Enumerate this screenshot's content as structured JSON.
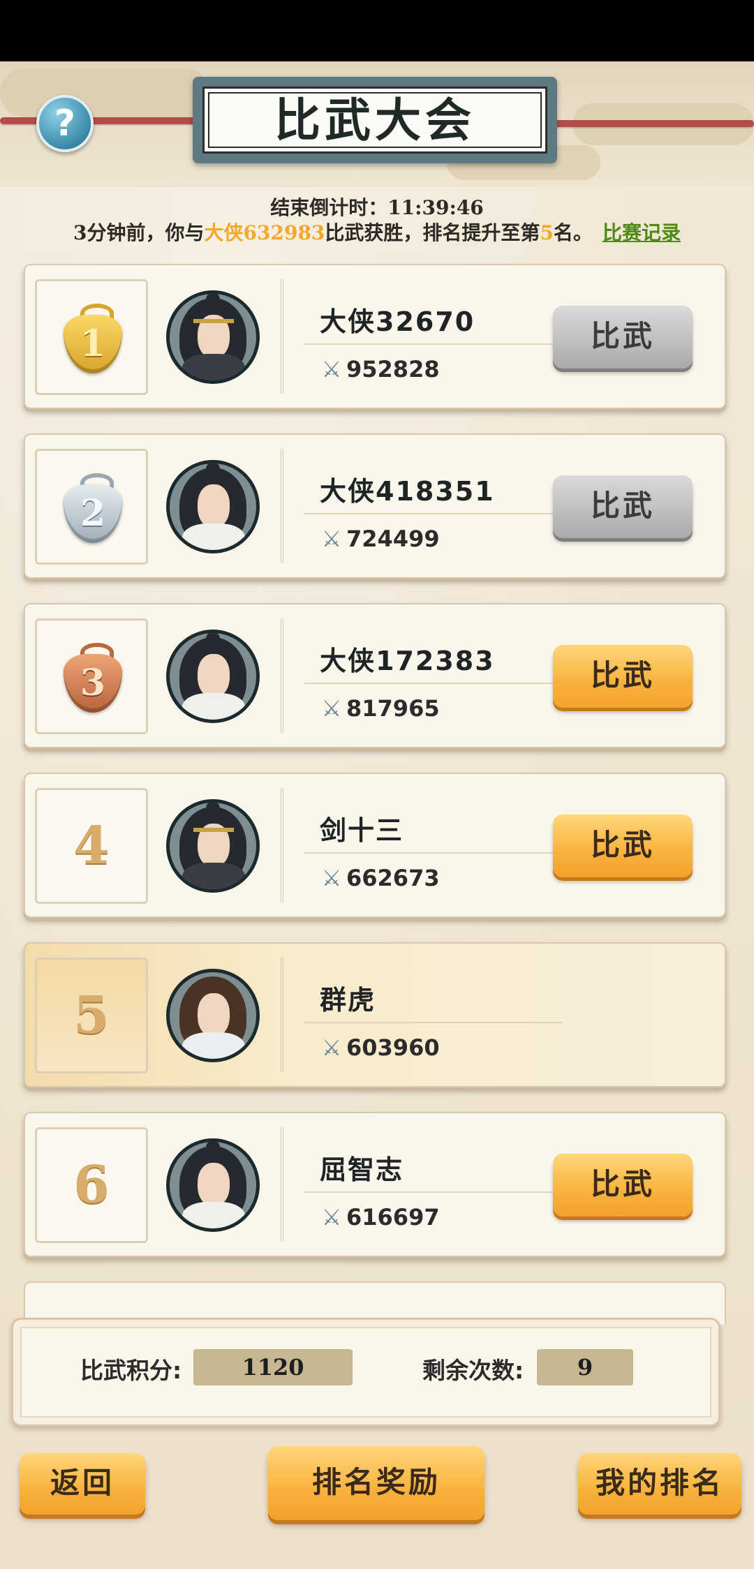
{
  "header": {
    "title": "比武大会",
    "help_glyph": "?",
    "countdown_label": "结束倒计时：",
    "countdown_value": "11:39:46",
    "notice_pre": "3分钟前，你与",
    "notice_opponent": "大侠632983",
    "notice_mid": "比武获胜，排名提升至第",
    "notice_rank": "5",
    "notice_post": "名。",
    "record_link": "比赛记录"
  },
  "colors": {
    "accent": "#f8b23c",
    "highlight": "#f4a72a",
    "link": "#4d8b12"
  },
  "players": [
    {
      "rank": "1",
      "medal": "gold",
      "name": "大侠32670",
      "power": "952828",
      "button": "比武",
      "button_state": "disabled",
      "avatar_style": "dark"
    },
    {
      "rank": "2",
      "medal": "silver",
      "name": "大侠418351",
      "power": "724499",
      "button": "比武",
      "button_state": "disabled",
      "avatar_style": "light"
    },
    {
      "rank": "3",
      "medal": "bronze",
      "name": "大侠172383",
      "power": "817965",
      "button": "比武",
      "button_state": "enabled",
      "avatar_style": "light"
    },
    {
      "rank": "4",
      "medal": "",
      "name": "剑十三",
      "power": "662673",
      "button": "比武",
      "button_state": "enabled",
      "avatar_style": "dark"
    },
    {
      "rank": "5",
      "medal": "",
      "name": "群虎",
      "power": "603960",
      "button": "",
      "button_state": "self",
      "avatar_style": "light"
    },
    {
      "rank": "6",
      "medal": "",
      "name": "屈智志",
      "power": "616697",
      "button": "比武",
      "button_state": "enabled",
      "avatar_style": "light"
    }
  ],
  "stats": {
    "score_label": "比武积分:",
    "score_value": "1120",
    "remaining_label": "剩余次数:",
    "remaining_value": "9"
  },
  "footer": {
    "back_label": "返回",
    "reward_label": "排名奖励",
    "my_rank_label": "我的排名"
  }
}
